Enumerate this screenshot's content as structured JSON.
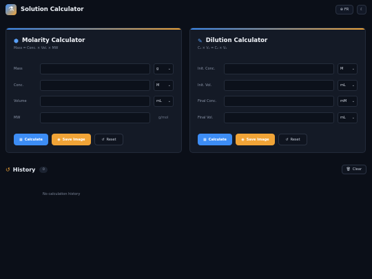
{
  "app": {
    "title": "Solution Calculator"
  },
  "header": {
    "lang_label": "FR"
  },
  "molarity": {
    "title": "Molarity Calculator",
    "formula": "Mass = Conc. × Vol. × MW",
    "fields": [
      {
        "label": "Mass",
        "unit": "g"
      },
      {
        "label": "Conc.",
        "unit": "M"
      },
      {
        "label": "Volume",
        "unit": "mL"
      },
      {
        "label": "MW",
        "suffix": "g/mol"
      }
    ],
    "calculate_label": "Calculate",
    "save_label": "Save Image",
    "reset_label": "Reset"
  },
  "dilution": {
    "title": "Dilution Calculator",
    "formula": "C₁ × V₁ = C₂ × V₂",
    "fields": [
      {
        "label": "Init. Conc.",
        "unit": "M"
      },
      {
        "label": "Init. Vol.",
        "unit": "mL"
      },
      {
        "label": "Final Conc.",
        "unit": "mM"
      },
      {
        "label": "Final Vol.",
        "unit": "mL"
      }
    ],
    "calculate_label": "Calculate",
    "save_label": "Save Image",
    "reset_label": "Reset"
  },
  "history": {
    "title": "History",
    "count": "0",
    "clear_label": "Clear",
    "empty_text": "No calculation history"
  },
  "colors": {
    "accent_blue": "#3d8df5",
    "accent_orange": "#f1a437",
    "background": "#0b0f18"
  }
}
